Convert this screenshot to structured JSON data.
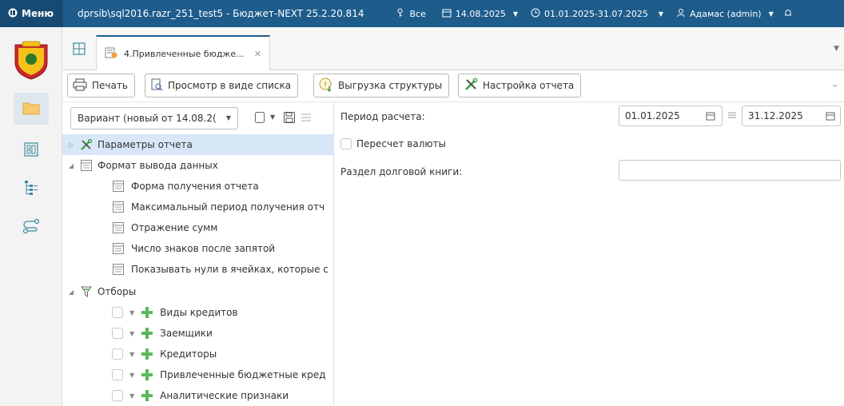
{
  "topbar": {
    "menu_label": "Меню",
    "app_title": "dprsib\\sql2016.razr_251_test5 - Бюджет-NEXT 25.2.20.814",
    "filter_label": "Все",
    "date": "14.08.2025",
    "period": "01.01.2025-31.07.2025",
    "user": "Адамас (admin)"
  },
  "tab": {
    "title": "4.Привлеченные бюдже..."
  },
  "toolbar": {
    "print_label": "Печать",
    "list_view_label": "Просмотр в виде списка",
    "export_structure_label": "Выгрузка структуры",
    "report_settings_label": "Настройка отчета"
  },
  "variant": {
    "selected": "Вариант (новый от 14.08.2("
  },
  "tree": {
    "items": [
      {
        "label": "Параметры отчета"
      },
      {
        "label": "Формат вывода данных"
      },
      {
        "label": "Форма получения отчета"
      },
      {
        "label": "Максимальный период получения отч"
      },
      {
        "label": "Отражение сумм"
      },
      {
        "label": "Число знаков после запятой"
      },
      {
        "label": "Показывать нули в ячейках, которые с"
      },
      {
        "label": "Отборы"
      },
      {
        "label": "Виды кредитов"
      },
      {
        "label": "Заемщики"
      },
      {
        "label": "Кредиторы"
      },
      {
        "label": "Привлеченные бюджетные кред"
      },
      {
        "label": "Аналитические признаки"
      }
    ]
  },
  "params": {
    "period_label": "Период расчета:",
    "period_from": "01.01.2025",
    "period_to": "31.12.2025",
    "currency_recalc_label": "Пересчет валюты",
    "debt_book_section_label": "Раздел долговой книги:",
    "debt_book_section_value": ""
  },
  "colors": {
    "topbar": "#1e5c8c",
    "selection": "#d7e7f7",
    "accent_green": "#4caf50"
  }
}
